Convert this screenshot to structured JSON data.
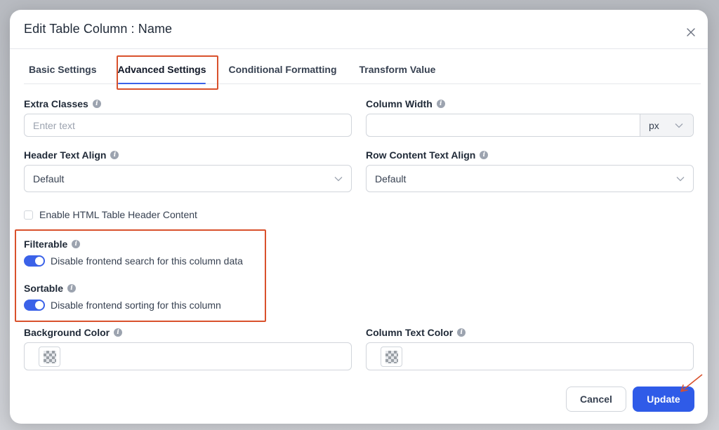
{
  "modal": {
    "title": "Edit Table Column : Name"
  },
  "tabs": [
    {
      "label": "Basic Settings"
    },
    {
      "label": "Advanced Settings"
    },
    {
      "label": "Conditional Formatting"
    },
    {
      "label": "Transform Value"
    }
  ],
  "fields": {
    "extra_classes": {
      "label": "Extra Classes",
      "placeholder": "Enter text",
      "value": ""
    },
    "column_width": {
      "label": "Column Width",
      "value": "",
      "unit": "px"
    },
    "header_text_align": {
      "label": "Header Text Align",
      "value": "Default"
    },
    "row_content_text_align": {
      "label": "Row Content Text Align",
      "value": "Default"
    },
    "enable_html_header": {
      "label": "Enable HTML Table Header Content",
      "checked": false
    },
    "filterable": {
      "label": "Filterable",
      "toggle_text": "Disable frontend search for this column data",
      "enabled": true
    },
    "sortable": {
      "label": "Sortable",
      "toggle_text": "Disable frontend sorting for this column",
      "enabled": true
    },
    "background_color": {
      "label": "Background Color"
    },
    "column_text_color": {
      "label": "Column Text Color"
    }
  },
  "buttons": {
    "cancel": "Cancel",
    "update": "Update"
  },
  "colors": {
    "accent": "#2f5be8",
    "highlight": "#d9512c"
  },
  "icons": {
    "close": "close-icon",
    "info": "info-icon",
    "chevron": "chevron-down-icon",
    "color_swatch": "transparent-swatch-icon",
    "annotation_arrow": "arrow-icon"
  }
}
